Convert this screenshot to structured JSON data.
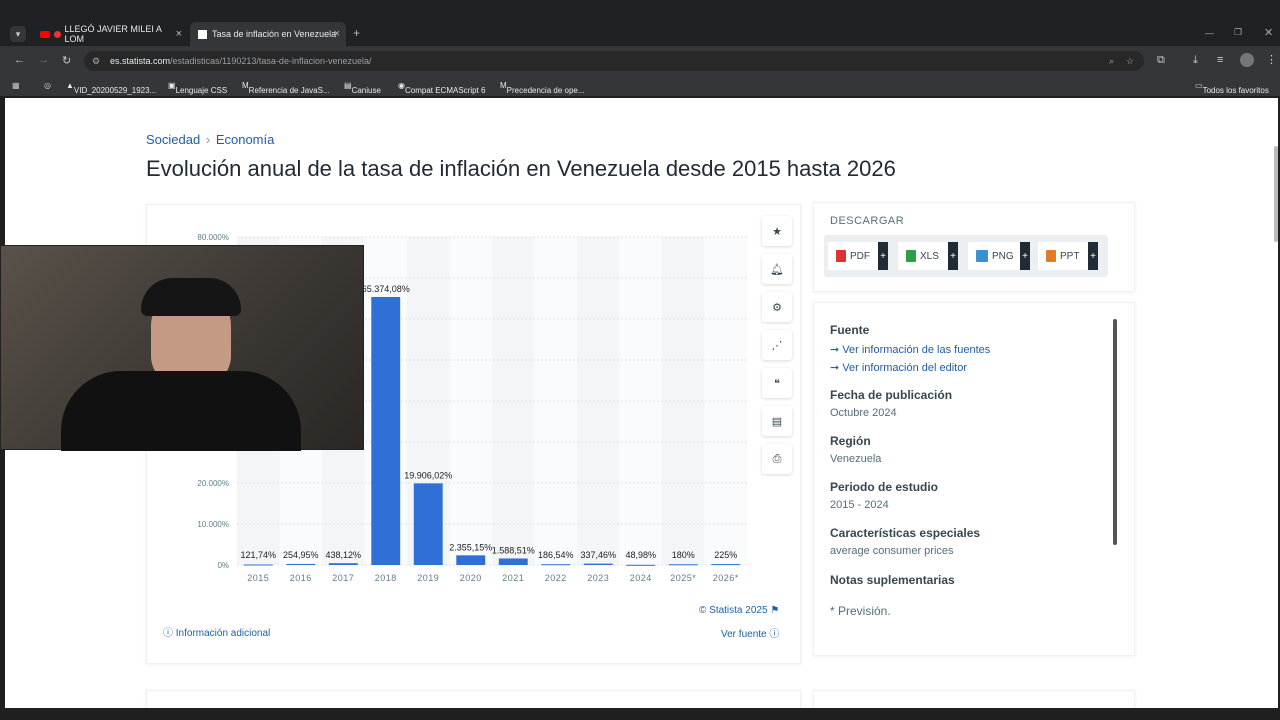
{
  "browser": {
    "tabs": [
      {
        "title": "LLEGÓ JAVIER MILEI A LOM",
        "close": "×"
      },
      {
        "title": "Tasa de inflación en Venezuela",
        "close": "×"
      }
    ],
    "new_tab": "+",
    "url_host": "es.statista.com",
    "url_path": "/estadisticas/1190213/tasa-de-inflacion-venezuela/",
    "bookmarks": [
      "VID_20200529_1923...",
      "Lenguaje CSS",
      "Referencia de JavaS...",
      "Caniuse",
      "Compat ECMAScript 6",
      "Precedencia de ope..."
    ],
    "bookmarks_folder": "Todos los favoritos"
  },
  "breadcrumb": {
    "first": "Sociedad",
    "sep": "›",
    "second": "Economía"
  },
  "page_title": "Evolución anual de la tasa de inflación en Venezuela desde 2015 hasta 2026",
  "chart_data": {
    "type": "bar",
    "categories": [
      "2015",
      "2016",
      "2017",
      "2018",
      "2019",
      "2020",
      "2021",
      "2022",
      "2023",
      "2024",
      "2025*",
      "2026*"
    ],
    "values": [
      121.74,
      254.95,
      438.12,
      65374.08,
      19906.02,
      2355.15,
      1588.51,
      186.54,
      337.46,
      48.98,
      180,
      225
    ],
    "data_labels": [
      "121,74%",
      "254,95%",
      "438,12%",
      "65.374,08%",
      "19.906,02%",
      "2.355,15%",
      "1.588,51%",
      "186,54%",
      "337,46%",
      "48,98%",
      "180%",
      "225%"
    ],
    "y_ticks": [
      "0%",
      "10.000%",
      "20.000%",
      "80.000%"
    ],
    "ylim": [
      0,
      80000
    ],
    "grid": true,
    "color": "#2f6fd6"
  },
  "chart_footer": {
    "credit": "© Statista 2025",
    "info": "Información adicional",
    "source": "Ver fuente"
  },
  "download": {
    "title": "DESCARGAR",
    "buttons": [
      "PDF",
      "XLS",
      "PNG",
      "PPT"
    ],
    "plus": "+"
  },
  "meta": {
    "fuente": "Fuente",
    "link1": "Ver información de las fuentes",
    "link2": "Ver información del editor",
    "fecha_label": "Fecha de publicación",
    "fecha": "Octubre 2024",
    "region_label": "Región",
    "region": "Venezuela",
    "periodo_label": "Periodo de estudio",
    "periodo": "2015 - 2024",
    "caract_label": "Características especiales",
    "caract": "average consumer prices",
    "notas_label": "Notas suplementarias",
    "notas": "* Previsión."
  }
}
